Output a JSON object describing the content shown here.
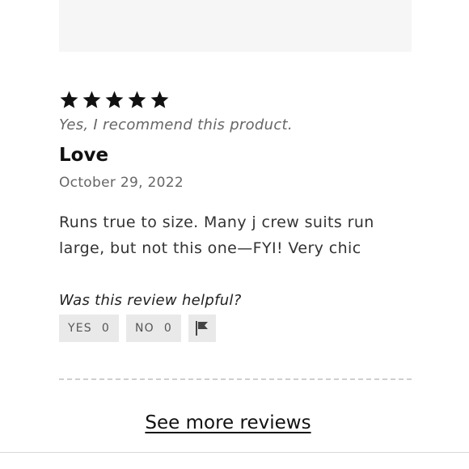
{
  "review": {
    "rating": 5,
    "max_rating": 5,
    "recommend_text": "Yes, I recommend this product.",
    "title": "Love",
    "date": "October 29, 2022",
    "body": "Runs true to size. Many j crew suits run large, but not this one—FYI! Very chic"
  },
  "helpful": {
    "question": "Was this review helpful?",
    "yes_label": "YES",
    "yes_count": "0",
    "no_label": "NO",
    "no_count": "0",
    "flag_icon": "flag-icon"
  },
  "footer": {
    "see_more_label": "See more reviews"
  },
  "colors": {
    "star": "#111111",
    "button_bg": "#e9e9e9",
    "panel_bg": "#f6f6f6"
  }
}
